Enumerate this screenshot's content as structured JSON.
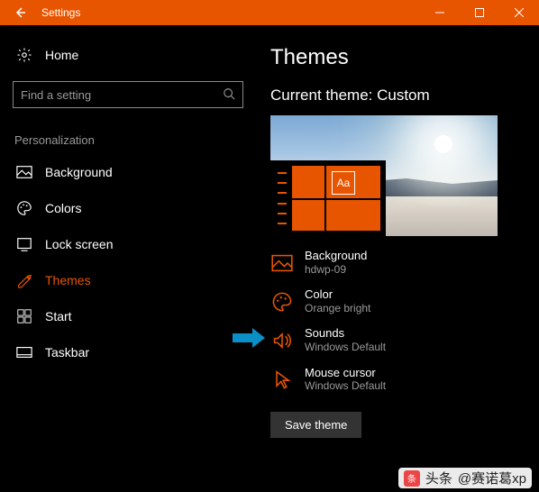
{
  "titlebar": {
    "title": "Settings"
  },
  "sidebar": {
    "home": "Home",
    "searchPlaceholder": "Find a setting",
    "category": "Personalization",
    "items": [
      {
        "label": "Background"
      },
      {
        "label": "Colors"
      },
      {
        "label": "Lock screen"
      },
      {
        "label": "Themes"
      },
      {
        "label": "Start"
      },
      {
        "label": "Taskbar"
      }
    ]
  },
  "main": {
    "heading": "Themes",
    "subheading": "Current theme: Custom",
    "previewSample": "Aa",
    "rows": [
      {
        "title": "Background",
        "sub": "hdwp-09"
      },
      {
        "title": "Color",
        "sub": "Orange bright"
      },
      {
        "title": "Sounds",
        "sub": "Windows Default"
      },
      {
        "title": "Mouse cursor",
        "sub": "Windows Default"
      }
    ],
    "saveLabel": "Save theme"
  },
  "footer": {
    "brand": "头条",
    "author": "@赛诺葛xp"
  }
}
